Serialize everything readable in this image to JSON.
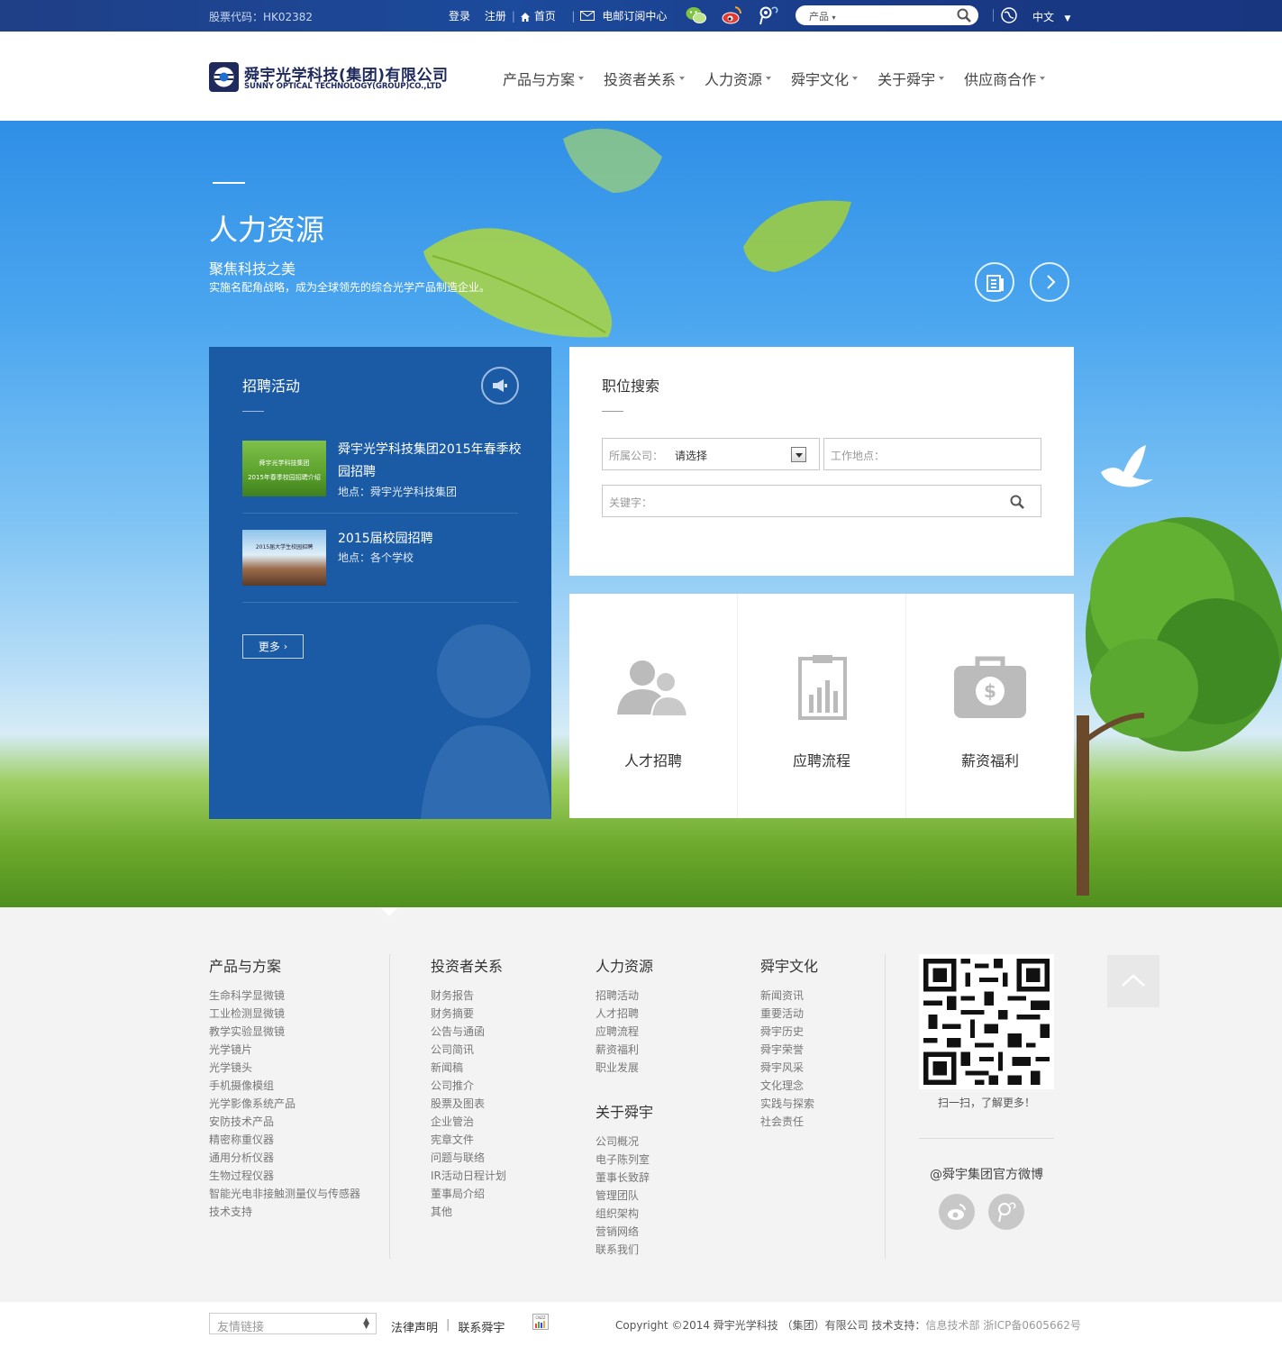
{
  "topbar": {
    "stock_code": "股票代码：HK02382",
    "login": "登录",
    "register": "注册",
    "home": "首页",
    "subscribe": "电邮订阅中心",
    "search_category": "产品",
    "language": "中文"
  },
  "header": {
    "logo_cn": "舜宇光学科技(集团)有限公司",
    "logo_en": "SUNNY OPTICAL TECHNOLOGY(GROUP)CO.,LTD",
    "nav": [
      "产品与方案",
      "投资者关系",
      "人力资源",
      "舜宇文化",
      "关于舜宇",
      "供应商合作"
    ]
  },
  "hero": {
    "title": "人力资源",
    "subtitle": "聚焦科技之美",
    "description": "实施名配角战略，成为全球领先的综合光学产品制造企业。"
  },
  "recruit": {
    "title": "招聘活动",
    "events": [
      {
        "title": "舜宇光学科技集团2015年春季校园招聘",
        "location": "地点：舜宇光学科技集团",
        "thumb_text": [
          "舜宇光学科技集团",
          "2015年春季校园招聘介绍"
        ]
      },
      {
        "title": "2015届校园招聘",
        "location": "地点：各个学校",
        "thumb_text": [
          "2015届大学生校园招聘"
        ]
      }
    ],
    "more": "更多"
  },
  "job_search": {
    "title": "职位搜索",
    "company_label": "所属公司：",
    "company_value": "请选择",
    "location_label": "工作地点：",
    "keyword_label": "关键字："
  },
  "tiles": [
    {
      "label": "人才招聘",
      "icon": "people-icon"
    },
    {
      "label": "应聘流程",
      "icon": "clipboard-icon"
    },
    {
      "label": "薪资福利",
      "icon": "money-bag-icon"
    }
  ],
  "footer": {
    "columns": [
      {
        "title": "产品与方案",
        "links": [
          "生命科学显微镜",
          "工业检测显微镜",
          "教学实验显微镜",
          "光学镜片",
          "光学镜头",
          "手机摄像模组",
          "光学影像系统产品",
          "安防技术产品",
          "精密称重仪器",
          "通用分析仪器",
          "生物过程仪器",
          "智能光电非接触测量仪与传感器",
          "技术支持"
        ]
      },
      {
        "title": "投资者关系",
        "links": [
          "财务报告",
          "财务摘要",
          "公告与通函",
          "公司简讯",
          "新闻稿",
          "公司推介",
          "股票及图表",
          "企业管治",
          "宪章文件",
          "问题与联络",
          "IR活动日程计划",
          "董事局介绍",
          "其他"
        ]
      },
      {
        "title": "人力资源",
        "links": [
          "招聘活动",
          "人才招聘",
          "应聘流程",
          "薪资福利",
          "职业发展"
        ]
      },
      {
        "title": "关于舜宇",
        "links": [
          "公司概况",
          "电子陈列室",
          "董事长致辞",
          "管理团队",
          "组织架构",
          "营销网络",
          "联系我们"
        ]
      },
      {
        "title": "舜宇文化",
        "links": [
          "新闻资讯",
          "重要活动",
          "舜宇历史",
          "舜宇荣誉",
          "舜宇风采",
          "文化理念",
          "实践与探索",
          "社会责任"
        ]
      }
    ],
    "qr_caption": "扫一扫，了解更多！",
    "weibo_name": "@舜宇集团官方微博"
  },
  "bottom": {
    "friendly_links": "友情链接",
    "legal": "法律声明",
    "contact": "联系舜宇",
    "copyright_main": "Copyright ©2014 舜宇光学科技 （集团）有限公司 技术支持：",
    "copyright_grey": "信息技术部 浙ICP备0605662号",
    "cnzz": "CNZZ"
  }
}
